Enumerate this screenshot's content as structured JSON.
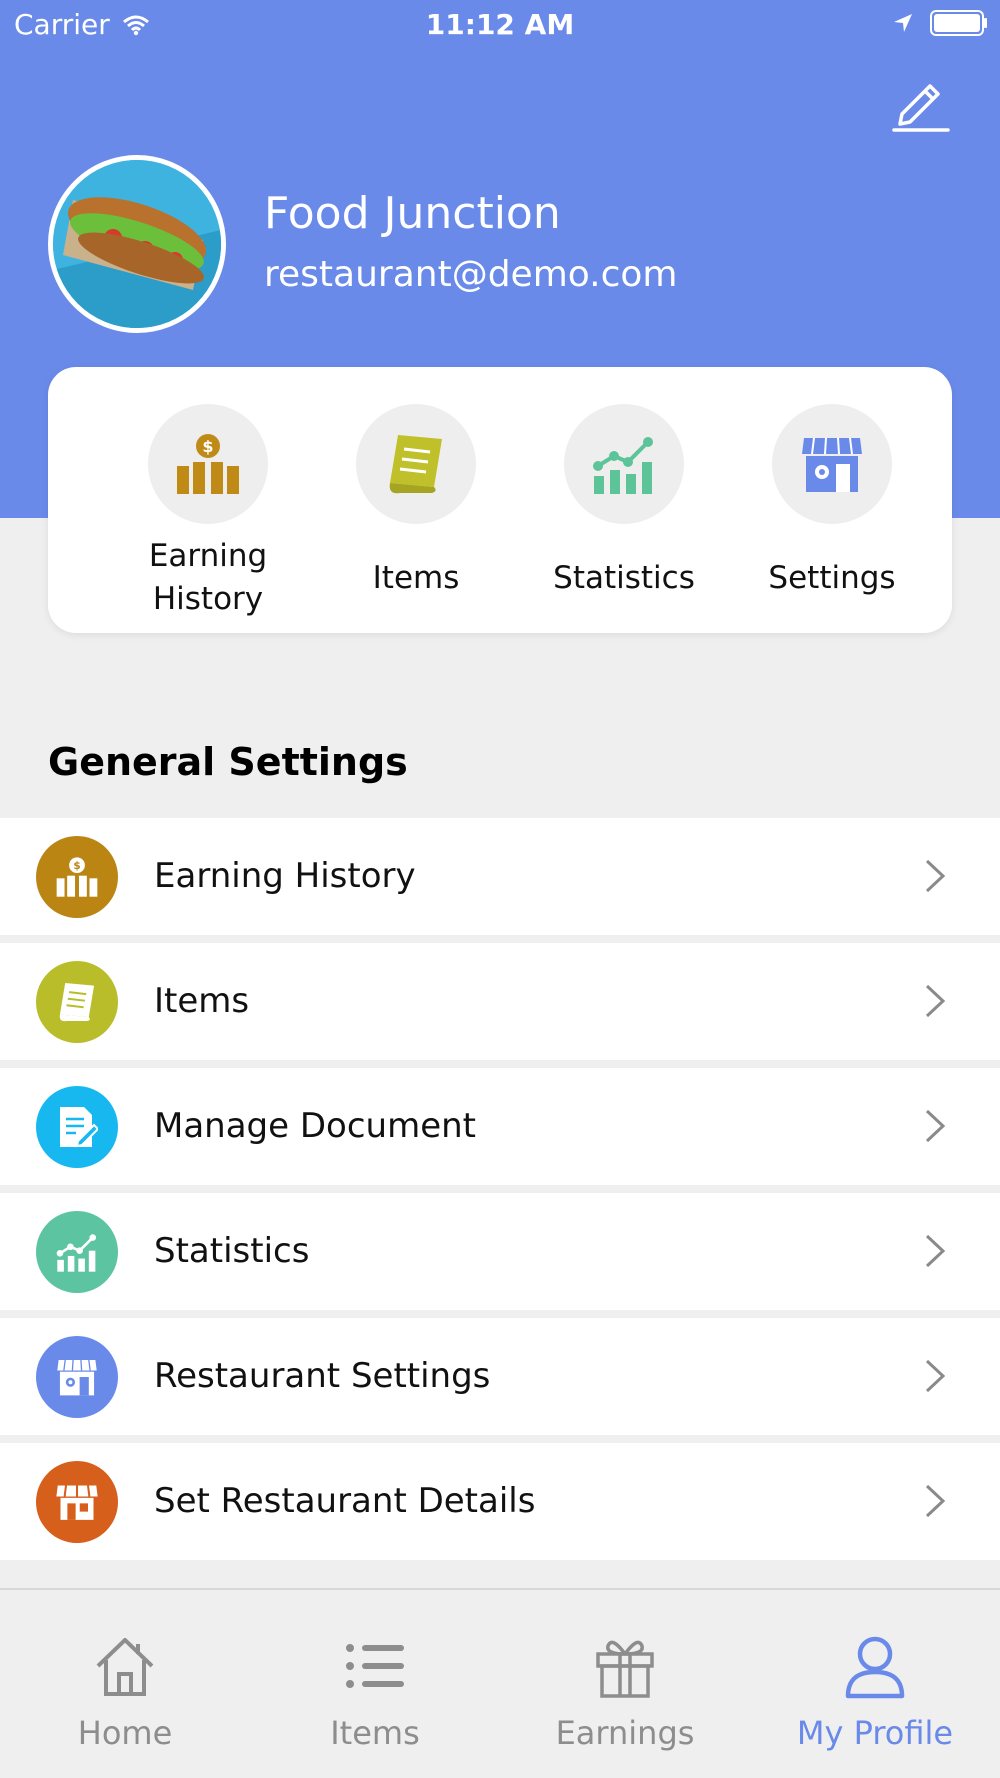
{
  "status_bar": {
    "carrier": "Carrier",
    "time": "11:12 AM"
  },
  "profile": {
    "name": "Food Junction",
    "email": "restaurant@demo.com"
  },
  "quick_actions": [
    {
      "label": "Earning History",
      "icon": "money-bars-icon",
      "color": "#c08a17"
    },
    {
      "label": "Items",
      "icon": "receipt-icon",
      "color": "#c0c02a"
    },
    {
      "label": "Statistics",
      "icon": "chart-icon",
      "color": "#5cc498"
    },
    {
      "label": "Settings",
      "icon": "store-settings-icon",
      "color": "#6a8aea"
    }
  ],
  "general_settings": {
    "title": "General Settings",
    "items": [
      {
        "label": "Earning History",
        "icon": "money-bars-icon",
        "color": "#bb8513"
      },
      {
        "label": "Items",
        "icon": "receipt-icon",
        "color": "#b9bd2a"
      },
      {
        "label": "Manage Document",
        "icon": "document-edit-icon",
        "color": "#17b8f0"
      },
      {
        "label": "Statistics",
        "icon": "chart-icon",
        "color": "#5cc4a0"
      },
      {
        "label": "Restaurant Settings",
        "icon": "store-settings-icon",
        "color": "#6a8aea"
      },
      {
        "label": "Set Restaurant Details",
        "icon": "store-icon",
        "color": "#d55f1b"
      }
    ]
  },
  "tabbar": {
    "items": [
      {
        "label": "Home",
        "icon": "home-icon"
      },
      {
        "label": "Items",
        "icon": "list-icon"
      },
      {
        "label": "Earnings",
        "icon": "gift-icon"
      },
      {
        "label": "My Profile",
        "icon": "user-icon"
      }
    ],
    "active": "My Profile",
    "active_color": "#6a8aea",
    "inactive_color": "#8d8d8d"
  },
  "colors": {
    "header": "#6a8aea",
    "background": "#efefef"
  }
}
